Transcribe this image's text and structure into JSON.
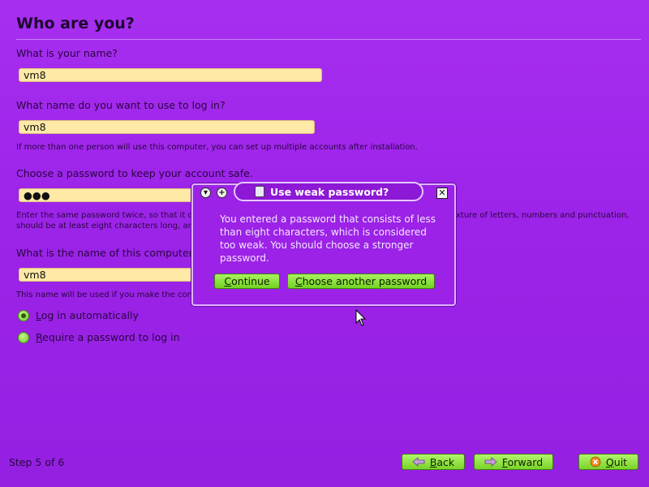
{
  "page": {
    "title": "Who are you?"
  },
  "form": {
    "name_label": "What is your name?",
    "name_value": "vm8",
    "login_label": "What name do you want to use to log in?",
    "login_value": "vm8",
    "login_hint": "If more than one person will use this computer, you can set up multiple accounts after installation.",
    "password_label": "Choose a password to keep your account safe.",
    "password_value": "●●●",
    "password_hint_line1": "Enter the same password twice, so that it c",
    "password_hint_line1_tail": "xture of letters, numbers and punctuation,",
    "password_hint_line2": "should be at least eight characters long, and",
    "computer_label": "What is the name of this computer?",
    "computer_value": "vm8",
    "computer_hint": "This name will be used if you make the com",
    "radio_auto_first": "L",
    "radio_auto_rest": "og in automatically",
    "radio_auto_checked": true,
    "radio_require_first": "R",
    "radio_require_rest": "equire a password to log in"
  },
  "dialog": {
    "title": "Use weak password?",
    "message": "You entered a password that consists of less than eight characters, which is considered too weak. You should choose a stronger password.",
    "continue_first": "C",
    "continue_rest": "ontinue",
    "choose_first": "C",
    "choose_rest": "hoose another password",
    "icons": {
      "minimize": "chevron-down-icon",
      "maximize": "plus-icon",
      "close": "close-icon",
      "app": "document-icon"
    }
  },
  "footer": {
    "step": "Step 5 of 6",
    "back_first": "B",
    "back_rest": "ack",
    "forward_first": "F",
    "forward_rest": "orward",
    "quit_first": "Q",
    "quit_rest": "uit"
  },
  "colors": {
    "background": "#9d24e9",
    "field": "#ffe9a6",
    "button": "#8ee23e"
  }
}
